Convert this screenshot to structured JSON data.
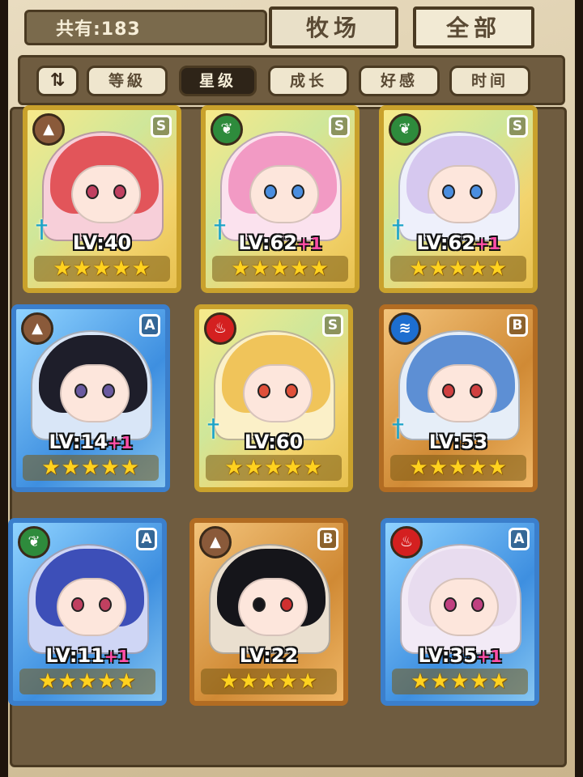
{
  "header": {
    "count_label": "共有:183",
    "ranch_button": "牧场",
    "all_button": "全部"
  },
  "sort": {
    "toggle_icon": "sort-toggle-icon",
    "tabs": [
      {
        "label": "等級",
        "active": false
      },
      {
        "label": "星级",
        "active": true
      },
      {
        "label": "成长",
        "active": false
      },
      {
        "label": "好感",
        "active": false
      },
      {
        "label": "时间",
        "active": false
      }
    ]
  },
  "cards": [
    {
      "lv": "LV:40",
      "plus": "",
      "rank": "S",
      "element": "earth-icon",
      "frame": "gold",
      "stars": 5,
      "sword": true
    },
    {
      "lv": "LV:62",
      "plus": "+1",
      "rank": "S",
      "element": "leaf-icon",
      "frame": "gold",
      "stars": 5,
      "sword": true
    },
    {
      "lv": "LV:62",
      "plus": "+1",
      "rank": "S",
      "element": "leaf-icon",
      "frame": "gold",
      "stars": 5,
      "sword": true
    },
    {
      "lv": "LV:14",
      "plus": "+1",
      "rank": "A",
      "element": "earth-icon",
      "frame": "blue",
      "stars": 5,
      "sword": false
    },
    {
      "lv": "LV:60",
      "plus": "",
      "rank": "S",
      "element": "fire-icon",
      "frame": "gold",
      "stars": 5,
      "sword": true
    },
    {
      "lv": "LV:53",
      "plus": "",
      "rank": "B",
      "element": "water-icon",
      "frame": "bronze",
      "stars": 5,
      "sword": true
    },
    {
      "lv": "LV:11",
      "plus": "+1",
      "rank": "A",
      "element": "leaf-icon",
      "frame": "blue",
      "stars": 5,
      "sword": false
    },
    {
      "lv": "LV:22",
      "plus": "",
      "rank": "B",
      "element": "earth-icon",
      "frame": "bronze",
      "stars": 5,
      "sword": false
    },
    {
      "lv": "LV:35",
      "plus": "+1",
      "rank": "A",
      "element": "fire-icon",
      "frame": "blue",
      "stars": 5,
      "sword": false
    }
  ],
  "colors": {
    "gold_frame": "#c9a12c",
    "blue_frame": "#3b7fcc",
    "bronze_frame": "#b26c22",
    "plus_text": "#ff4fa8",
    "star": "#ffd21f"
  }
}
